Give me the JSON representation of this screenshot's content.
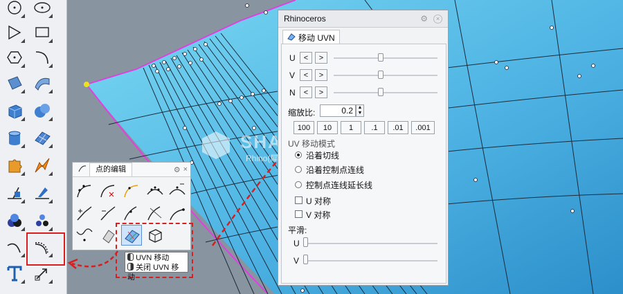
{
  "panel": {
    "title": "Rhinoceros",
    "tab_label": "移动 UVN",
    "u_label": "U",
    "v_label": "V",
    "n_label": "N",
    "minus": "<",
    "plus": ">",
    "scale_label": "缩放比:",
    "scale_value": "0.2",
    "presets": [
      "100",
      "10",
      "1",
      ".1",
      ".01",
      ".001"
    ],
    "uv_direction_label": "UV 移动模式",
    "options": [
      "沿着切线",
      "沿着控制点连线",
      "控制点连线延长线"
    ],
    "selected_option": 0,
    "u_symmetric": "U 对称",
    "v_symmetric": "V 对称",
    "smooth_label": "平滑:",
    "smooth_u": "U",
    "smooth_v": "V",
    "u_level": 0.45,
    "v_level": 0.45,
    "n_level": 0.45
  },
  "floating_toolbar": {
    "title": "点的编辑"
  },
  "tooltip": {
    "line1": "UVN 移动",
    "line2": "关闭 UVN 移动"
  },
  "watermark": {
    "brand": "SHARPER3D",
    "subtitle": "Rhino(犀牛)中国技术支持&推广中心"
  },
  "colors": {
    "surface_light": "#6ad0ef",
    "surface_dark": "#2e8fc6",
    "edge": "#e040e0",
    "highlight": "#f0e020",
    "callout": "#d81e1e"
  }
}
